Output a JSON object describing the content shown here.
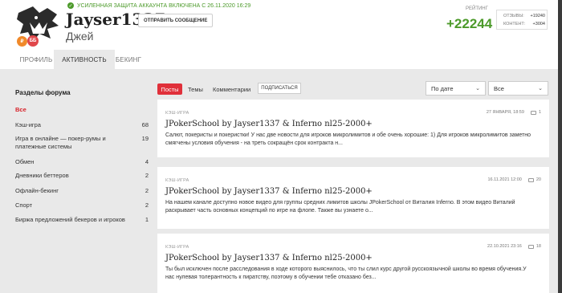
{
  "profile": {
    "protection_text": "УСИЛЕННАЯ ЗАЩИТА АККАУНТА ВКЛЮЧЕНА С 26.11.2020  16:29",
    "username": "Jayser1337",
    "real_name": "Джей",
    "send_message_label": "ОТПРАВИТЬ СООБЩЕНИЕ",
    "badges": [
      "₽",
      "ББ"
    ],
    "rating_label": "РЕЙТИНГ",
    "rating_value": "+22244",
    "stats": [
      {
        "label": "ОТЗЫВЫ:",
        "value": "+19240"
      },
      {
        "label": "КОНТЕНТ:",
        "value": "+3004"
      }
    ]
  },
  "tabs": [
    "ПРОФИЛЬ",
    "АКТИВНОСТЬ",
    "БЕКИНГ"
  ],
  "sidebar": {
    "title": "Разделы форума",
    "items": [
      {
        "label": "Все",
        "count": ""
      },
      {
        "label": "Кэш-игра",
        "count": "68"
      },
      {
        "label": "Игра в онлайне — покер-румы и платежные системы",
        "count": "19"
      },
      {
        "label": "Обмен",
        "count": "4"
      },
      {
        "label": "Дневники беттеров",
        "count": "2"
      },
      {
        "label": "Офлайн-бекинг",
        "count": "2"
      },
      {
        "label": "Спорт",
        "count": "2"
      },
      {
        "label": "Биржа предложений бекеров и игроков",
        "count": "1"
      }
    ]
  },
  "filters": {
    "posts": "Посты",
    "topics": "Темы",
    "comments": "Комментарии",
    "subscribe": "ПОДПИСАТЬСЯ",
    "sort_value": "По дате",
    "scope_value": "Все"
  },
  "posts": [
    {
      "category": "КЭШ-ИГРА",
      "date": "27 ЯНВАРЯ, 18:59",
      "comments": "1",
      "title": "JPokerSchool by Jayser1337 & Inferno nl25-2000+",
      "text": "Салют, покеристы и покеристки! У нас две новости для игроков микролимитов и обе очень хорошие: 1) Для игроков микролимитов заметно смягчены условия обучения - на треть сокращён срок контракта н..."
    },
    {
      "category": "КЭШ-ИГРА",
      "date": "16.11.2021 12:00",
      "comments": "20",
      "title": "JPokerSchool by Jayser1337 & Inferno nl25-2000+",
      "text": "На нашем канале доступно новое видео для группы средних лимитов школы JPokerSchool от Виталия Inferno. В этом видео Виталий раскрывает часть основных концепций по игре на флопе. Также вы узнаете о..."
    },
    {
      "category": "КЭШ-ИГРА",
      "date": "22.10.2021 23:16",
      "comments": "18",
      "title": "JPokerSchool by Jayser1337 & Inferno nl25-2000+",
      "text": "Ты был исключен после расследования в ходе которого выяснилось, что ты слил курс другой русскоязычной школы во время обучения.У нас нулевая толерантность к пиратству, поэтому в обучении тебе отказано без..."
    }
  ],
  "colors": {
    "accent": "#e0303a",
    "green": "#4c9a2a",
    "background": "#e9e9e9"
  }
}
